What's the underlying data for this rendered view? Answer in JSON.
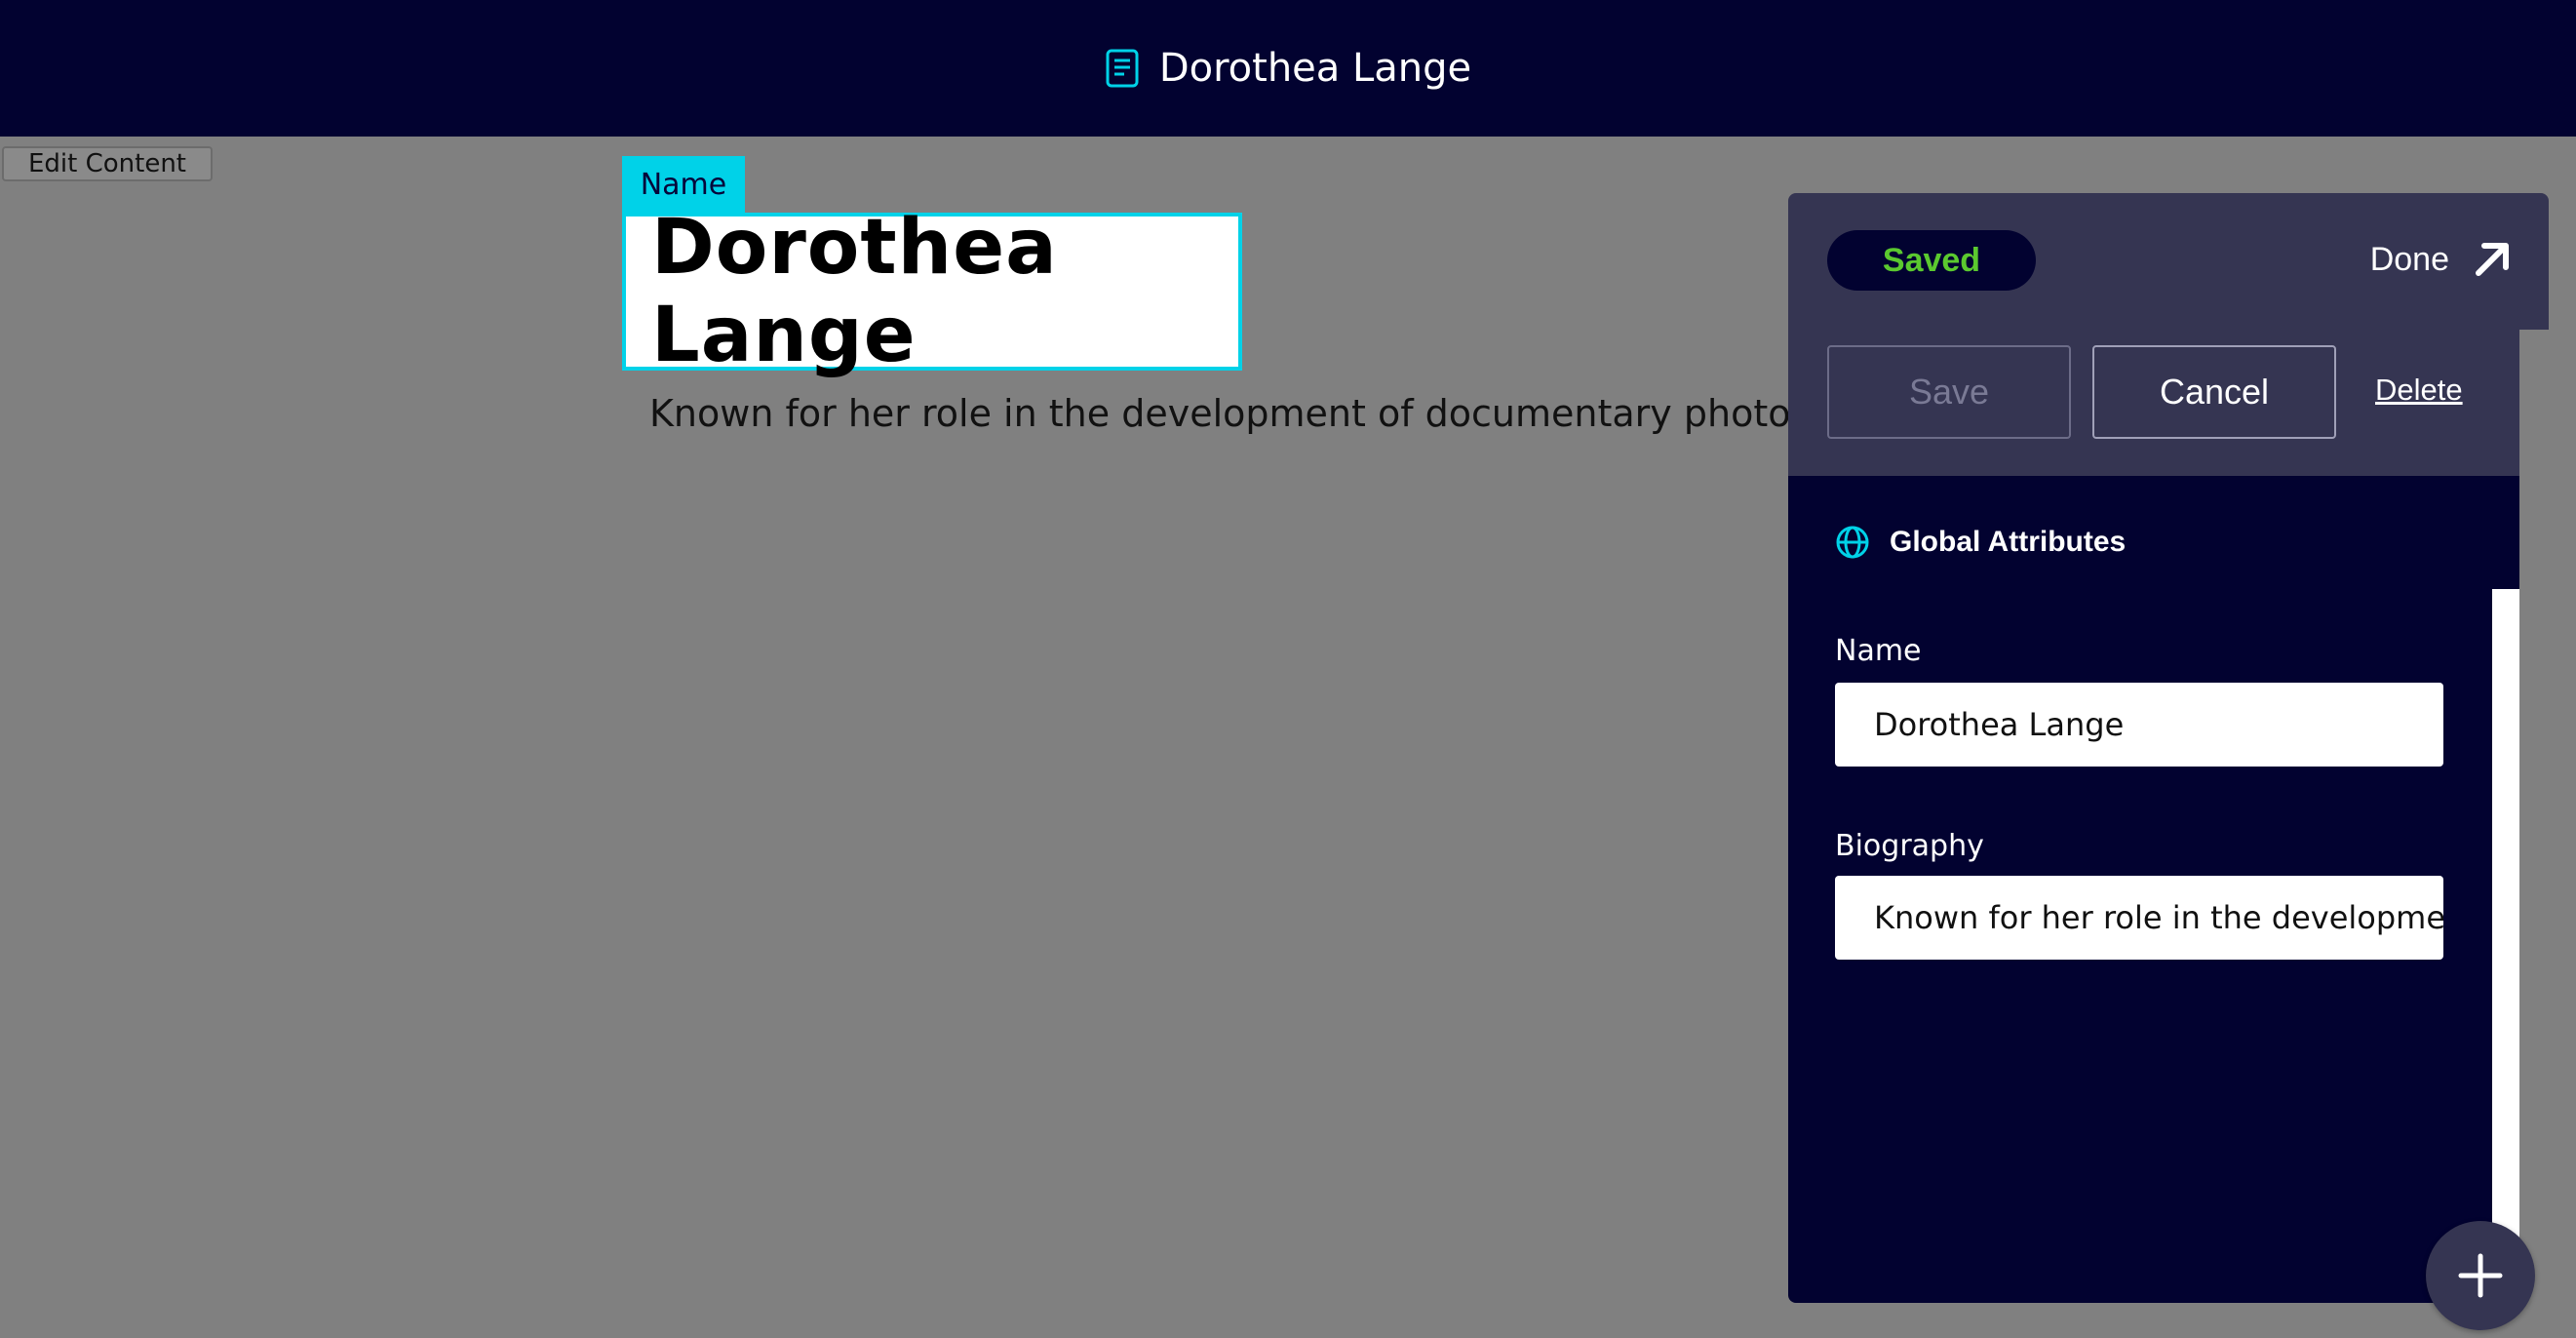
{
  "header": {
    "title": "Dorothea Lange",
    "icon": "document-icon",
    "background": "#020230",
    "accent": "#00d2e8"
  },
  "toolbar": {
    "edit_content_label": "Edit Content"
  },
  "editor": {
    "name_tag": "Name",
    "name_value": "Dorothea Lange",
    "bio_value": "Known for her role in the development of documentary photograph"
  },
  "panel": {
    "status_label": "Saved",
    "status_color": "#5bc92f",
    "done_label": "Done",
    "save_label": "Save",
    "cancel_label": "Cancel",
    "delete_label": "Delete",
    "section_title": "Global Attributes",
    "section_icon": "globe-icon",
    "fields": [
      {
        "label": "Name",
        "value": "Dorothea Lange"
      },
      {
        "label": "Biography",
        "value": "Known for her role in the developme"
      }
    ]
  },
  "fab": {
    "icon": "plus-icon"
  }
}
